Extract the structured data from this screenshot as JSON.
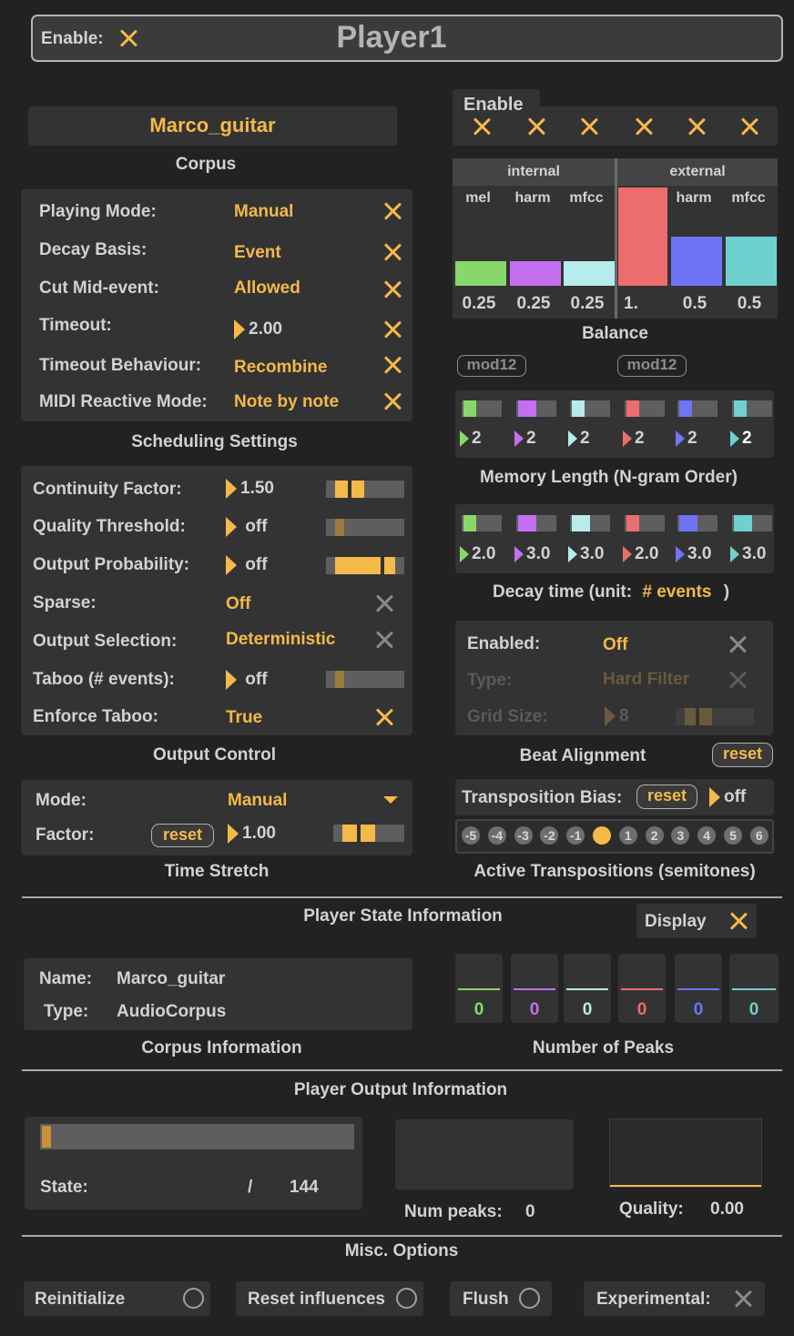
{
  "header": {
    "enable_label": "Enable:",
    "title": "Player1"
  },
  "corpus": {
    "name": "Marco_guitar",
    "caption": "Corpus"
  },
  "scheduling": {
    "caption": "Scheduling Settings",
    "rows": [
      {
        "label": "Playing Mode:",
        "value": "Manual"
      },
      {
        "label": "Decay Basis:",
        "value": "Event"
      },
      {
        "label": "Cut Mid-event:",
        "value": "Allowed"
      },
      {
        "label": "Timeout:",
        "value": "2.00"
      },
      {
        "label": "Timeout Behaviour:",
        "value": "Recombine"
      },
      {
        "label": "MIDI Reactive Mode:",
        "value": "Note by note"
      }
    ]
  },
  "output_control": {
    "caption": "Output Control",
    "rows": [
      {
        "label": "Continuity Factor:",
        "value": "1.50"
      },
      {
        "label": "Quality Threshold:",
        "value": "off"
      },
      {
        "label": "Output Probability:",
        "value": "off"
      },
      {
        "label": "Sparse:",
        "value": "Off"
      },
      {
        "label": "Output Selection:",
        "value": "Deterministic"
      },
      {
        "label": "Taboo (# events):",
        "value": "off"
      },
      {
        "label": "Enforce Taboo:",
        "value": "True"
      }
    ]
  },
  "time_stretch": {
    "caption": "Time Stretch",
    "mode_label": "Mode:",
    "mode_value": "Manual",
    "factor_label": "Factor:",
    "reset_label": "reset",
    "factor_value": "1.00"
  },
  "enable_panel": {
    "label": "Enable"
  },
  "balance": {
    "caption": "Balance",
    "internal_label": "internal",
    "external_label": "external",
    "columns": [
      {
        "name": "mel",
        "value": "0.25",
        "color": "#87d86a"
      },
      {
        "name": "harm",
        "value": "0.25",
        "color": "#c46ff0"
      },
      {
        "name": "mfcc",
        "value": "0.25",
        "color": "#b6ecec"
      },
      {
        "name": "mel",
        "value": "1.",
        "color": "#ec6d6d"
      },
      {
        "name": "harm",
        "value": "0.5",
        "color": "#6e74f5"
      },
      {
        "name": "mfcc",
        "value": "0.5",
        "color": "#6fd0d0"
      }
    ]
  },
  "mod12": {
    "left": "mod12",
    "right": "mod12"
  },
  "memory": {
    "caption": "Memory Length (N-gram Order)",
    "values": [
      "2",
      "2",
      "2",
      "2",
      "2",
      "2"
    ]
  },
  "decay": {
    "caption_prefix": "Decay time (unit:",
    "caption_unit": "# events",
    "caption_suffix": ")",
    "values": [
      "2.0",
      "3.0",
      "3.0",
      "2.0",
      "3.0",
      "3.0"
    ]
  },
  "beat": {
    "caption": "Beat Alignment",
    "reset_label": "reset",
    "rows": [
      {
        "label": "Enabled:",
        "value": "Off"
      },
      {
        "label": "Type:",
        "value": "Hard Filter"
      },
      {
        "label": "Grid Size:",
        "value": "8"
      }
    ]
  },
  "transposition": {
    "bias_label": "Transposition Bias:",
    "reset_label": "reset",
    "bias_value": "off",
    "caption": "Active Transpositions (semitones)",
    "steps": [
      "-5",
      "-4",
      "-3",
      "-2",
      "-1",
      "0",
      "1",
      "2",
      "3",
      "4",
      "5",
      "6"
    ],
    "active": "0"
  },
  "state_info": {
    "heading": "Player State Information",
    "display_label": "Display"
  },
  "corpus_info": {
    "caption": "Corpus Information",
    "name_label": "Name:",
    "name_value": "Marco_guitar",
    "type_label": "Type:",
    "type_value": "AudioCorpus"
  },
  "peaks": {
    "caption": "Number of Peaks",
    "values": [
      "0",
      "0",
      "0",
      "0",
      "0",
      "0"
    ]
  },
  "output_info": {
    "heading": "Player Output Information",
    "state_label": "State:",
    "state_sep": "/",
    "state_total": "144",
    "num_peaks_label": "Num peaks:",
    "num_peaks_value": "0",
    "quality_label": "Quality:",
    "quality_value": "0.00"
  },
  "misc": {
    "heading": "Misc. Options",
    "reinitialize": "Reinitialize",
    "reset_influences": "Reset influences",
    "flush": "Flush",
    "experimental": "Experimental:"
  },
  "colors": {
    "accent": "#f5b94a",
    "panel": "#333333",
    "background": "#222222"
  }
}
